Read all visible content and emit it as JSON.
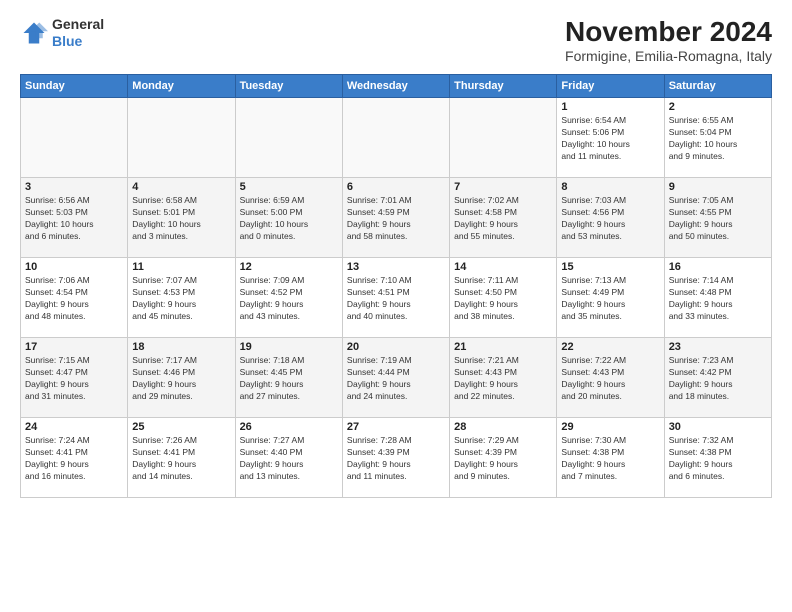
{
  "header": {
    "logo": {
      "general": "General",
      "blue": "Blue"
    },
    "title": "November 2024",
    "location": "Formigine, Emilia-Romagna, Italy"
  },
  "days_of_week": [
    "Sunday",
    "Monday",
    "Tuesday",
    "Wednesday",
    "Thursday",
    "Friday",
    "Saturday"
  ],
  "weeks": [
    [
      {
        "day": null,
        "info": null
      },
      {
        "day": null,
        "info": null
      },
      {
        "day": null,
        "info": null
      },
      {
        "day": null,
        "info": null
      },
      {
        "day": null,
        "info": null
      },
      {
        "day": "1",
        "info": "Sunrise: 6:54 AM\nSunset: 5:06 PM\nDaylight: 10 hours\nand 11 minutes."
      },
      {
        "day": "2",
        "info": "Sunrise: 6:55 AM\nSunset: 5:04 PM\nDaylight: 10 hours\nand 9 minutes."
      }
    ],
    [
      {
        "day": "3",
        "info": "Sunrise: 6:56 AM\nSunset: 5:03 PM\nDaylight: 10 hours\nand 6 minutes."
      },
      {
        "day": "4",
        "info": "Sunrise: 6:58 AM\nSunset: 5:01 PM\nDaylight: 10 hours\nand 3 minutes."
      },
      {
        "day": "5",
        "info": "Sunrise: 6:59 AM\nSunset: 5:00 PM\nDaylight: 10 hours\nand 0 minutes."
      },
      {
        "day": "6",
        "info": "Sunrise: 7:01 AM\nSunset: 4:59 PM\nDaylight: 9 hours\nand 58 minutes."
      },
      {
        "day": "7",
        "info": "Sunrise: 7:02 AM\nSunset: 4:58 PM\nDaylight: 9 hours\nand 55 minutes."
      },
      {
        "day": "8",
        "info": "Sunrise: 7:03 AM\nSunset: 4:56 PM\nDaylight: 9 hours\nand 53 minutes."
      },
      {
        "day": "9",
        "info": "Sunrise: 7:05 AM\nSunset: 4:55 PM\nDaylight: 9 hours\nand 50 minutes."
      }
    ],
    [
      {
        "day": "10",
        "info": "Sunrise: 7:06 AM\nSunset: 4:54 PM\nDaylight: 9 hours\nand 48 minutes."
      },
      {
        "day": "11",
        "info": "Sunrise: 7:07 AM\nSunset: 4:53 PM\nDaylight: 9 hours\nand 45 minutes."
      },
      {
        "day": "12",
        "info": "Sunrise: 7:09 AM\nSunset: 4:52 PM\nDaylight: 9 hours\nand 43 minutes."
      },
      {
        "day": "13",
        "info": "Sunrise: 7:10 AM\nSunset: 4:51 PM\nDaylight: 9 hours\nand 40 minutes."
      },
      {
        "day": "14",
        "info": "Sunrise: 7:11 AM\nSunset: 4:50 PM\nDaylight: 9 hours\nand 38 minutes."
      },
      {
        "day": "15",
        "info": "Sunrise: 7:13 AM\nSunset: 4:49 PM\nDaylight: 9 hours\nand 35 minutes."
      },
      {
        "day": "16",
        "info": "Sunrise: 7:14 AM\nSunset: 4:48 PM\nDaylight: 9 hours\nand 33 minutes."
      }
    ],
    [
      {
        "day": "17",
        "info": "Sunrise: 7:15 AM\nSunset: 4:47 PM\nDaylight: 9 hours\nand 31 minutes."
      },
      {
        "day": "18",
        "info": "Sunrise: 7:17 AM\nSunset: 4:46 PM\nDaylight: 9 hours\nand 29 minutes."
      },
      {
        "day": "19",
        "info": "Sunrise: 7:18 AM\nSunset: 4:45 PM\nDaylight: 9 hours\nand 27 minutes."
      },
      {
        "day": "20",
        "info": "Sunrise: 7:19 AM\nSunset: 4:44 PM\nDaylight: 9 hours\nand 24 minutes."
      },
      {
        "day": "21",
        "info": "Sunrise: 7:21 AM\nSunset: 4:43 PM\nDaylight: 9 hours\nand 22 minutes."
      },
      {
        "day": "22",
        "info": "Sunrise: 7:22 AM\nSunset: 4:43 PM\nDaylight: 9 hours\nand 20 minutes."
      },
      {
        "day": "23",
        "info": "Sunrise: 7:23 AM\nSunset: 4:42 PM\nDaylight: 9 hours\nand 18 minutes."
      }
    ],
    [
      {
        "day": "24",
        "info": "Sunrise: 7:24 AM\nSunset: 4:41 PM\nDaylight: 9 hours\nand 16 minutes."
      },
      {
        "day": "25",
        "info": "Sunrise: 7:26 AM\nSunset: 4:41 PM\nDaylight: 9 hours\nand 14 minutes."
      },
      {
        "day": "26",
        "info": "Sunrise: 7:27 AM\nSunset: 4:40 PM\nDaylight: 9 hours\nand 13 minutes."
      },
      {
        "day": "27",
        "info": "Sunrise: 7:28 AM\nSunset: 4:39 PM\nDaylight: 9 hours\nand 11 minutes."
      },
      {
        "day": "28",
        "info": "Sunrise: 7:29 AM\nSunset: 4:39 PM\nDaylight: 9 hours\nand 9 minutes."
      },
      {
        "day": "29",
        "info": "Sunrise: 7:30 AM\nSunset: 4:38 PM\nDaylight: 9 hours\nand 7 minutes."
      },
      {
        "day": "30",
        "info": "Sunrise: 7:32 AM\nSunset: 4:38 PM\nDaylight: 9 hours\nand 6 minutes."
      }
    ]
  ]
}
